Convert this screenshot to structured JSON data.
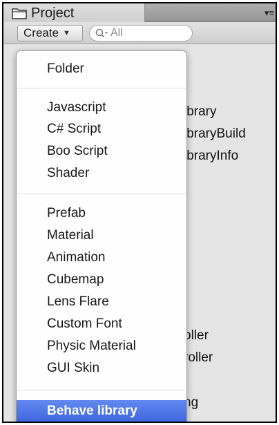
{
  "panel": {
    "tab_title": "Project",
    "tab_icon": "folder-icon",
    "menu_icon": "panel-menu-icon",
    "menu_glyph": "▾≡"
  },
  "toolbar": {
    "create_label": "Create",
    "create_arrow": "▼",
    "search_placeholder": "All",
    "search_icon": "search-icon"
  },
  "tree_visible": [
    "ibrary",
    "ibraryBuild",
    "ibraryInfo",
    "oller",
    "roller",
    "ng"
  ],
  "create_menu": {
    "items": [
      "Folder",
      "Javascript",
      "C# Script",
      "Boo Script",
      "Shader",
      "Prefab",
      "Material",
      "Animation",
      "Cubemap",
      "Lens Flare",
      "Custom Font",
      "Physic Material",
      "GUI Skin",
      "Behave library"
    ],
    "selected_label": "Behave library",
    "highlight_color": "#3d6ae3"
  }
}
